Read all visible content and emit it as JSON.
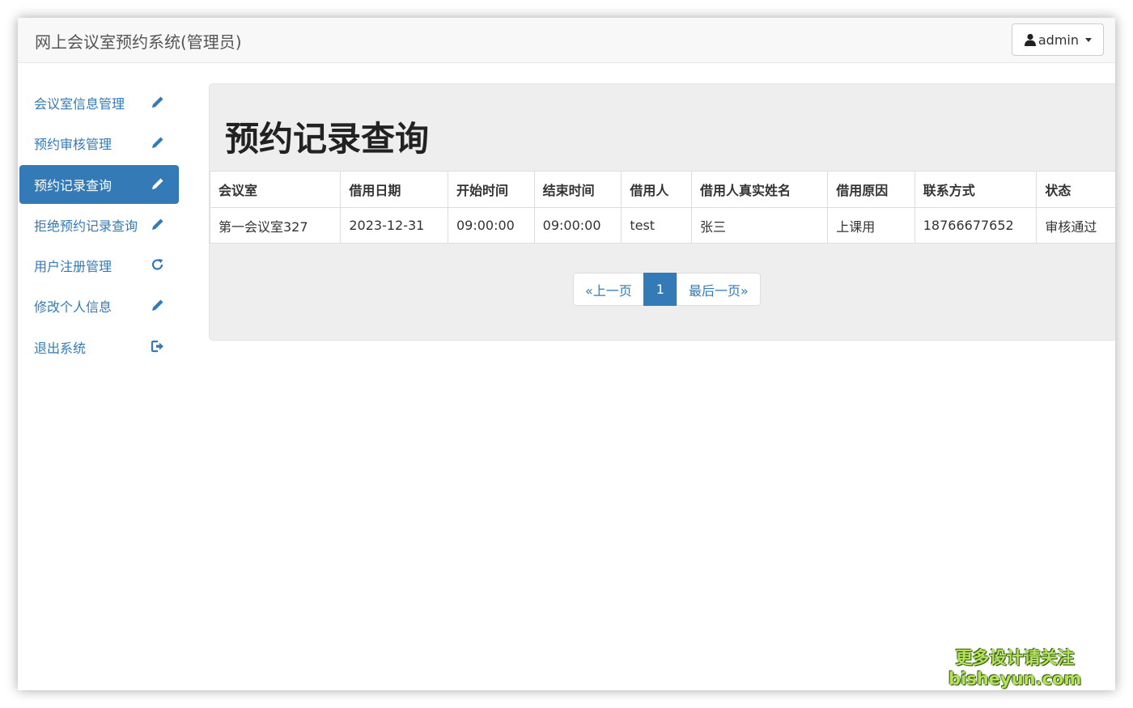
{
  "app": {
    "title": "网上会议室预约系统(管理员)",
    "user_label": "admin"
  },
  "sidebar": {
    "items": [
      {
        "label": "会议室信息管理",
        "icon": "pencil-icon",
        "active": false
      },
      {
        "label": "预约审核管理",
        "icon": "pencil-icon",
        "active": false
      },
      {
        "label": "预约记录查询",
        "icon": "pencil-icon",
        "active": true
      },
      {
        "label": "拒绝预约记录查询",
        "icon": "pencil-icon",
        "active": false
      },
      {
        "label": "用户注册管理",
        "icon": "refresh-icon",
        "active": false
      },
      {
        "label": "修改个人信息",
        "icon": "pencil-icon",
        "active": false
      },
      {
        "label": "退出系统",
        "icon": "logout-icon",
        "active": false
      }
    ]
  },
  "main": {
    "title": "预约记录查询",
    "table": {
      "headers": [
        "会议室",
        "借用日期",
        "开始时间",
        "结束时间",
        "借用人",
        "借用人真实姓名",
        "借用原因",
        "联系方式",
        "状态"
      ],
      "rows": [
        [
          "第一会议室327",
          "2023-12-31",
          "09:00:00",
          "09:00:00",
          "test",
          "张三",
          "上课用",
          "18766677652",
          "审核通过"
        ]
      ]
    },
    "pagination": {
      "prev": "«上一页",
      "current": "1",
      "last": "最后一页»"
    }
  },
  "watermark": {
    "line1": "更多设计请关注",
    "line2": "bisheyun.com"
  },
  "colors": {
    "primary": "#337ab7",
    "panel_bg": "#eeeeee",
    "navbar_bg": "#f8f8f8"
  }
}
